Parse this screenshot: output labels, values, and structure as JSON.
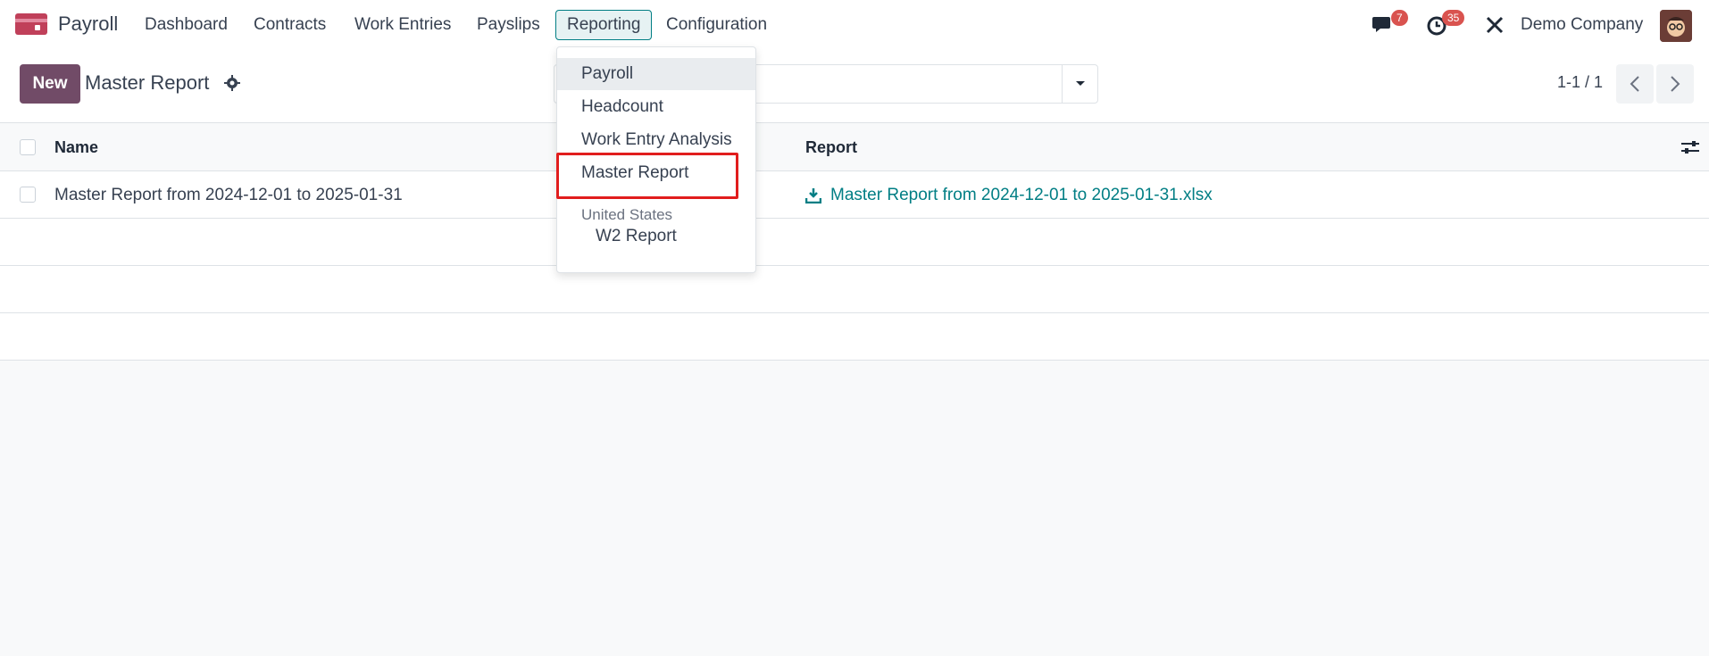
{
  "navbar": {
    "app_name": "Payroll",
    "menu": [
      "Dashboard",
      "Contracts",
      "Work Entries",
      "Payslips",
      "Reporting",
      "Configuration"
    ],
    "messages_count": "7",
    "activities_count": "35",
    "company": "Demo Company"
  },
  "control_panel": {
    "new_label": "New",
    "breadcrumb": "Master Report",
    "pager": "1-1 / 1"
  },
  "list": {
    "headers": {
      "name": "Name",
      "report": "Report"
    },
    "rows": [
      {
        "name": "Master Report from 2024-12-01 to 2025-01-31",
        "report": "Master Report from 2024-12-01 to 2025-01-31.xlsx"
      }
    ]
  },
  "dropdown": {
    "items": [
      "Payroll",
      "Headcount",
      "Work Entry Analysis",
      "Master Report"
    ],
    "section": "United States",
    "sub_items": [
      "W2 Report"
    ]
  },
  "colors": {
    "brand": "#714b67",
    "link": "#017e84",
    "highlight": "#e11d1d"
  }
}
